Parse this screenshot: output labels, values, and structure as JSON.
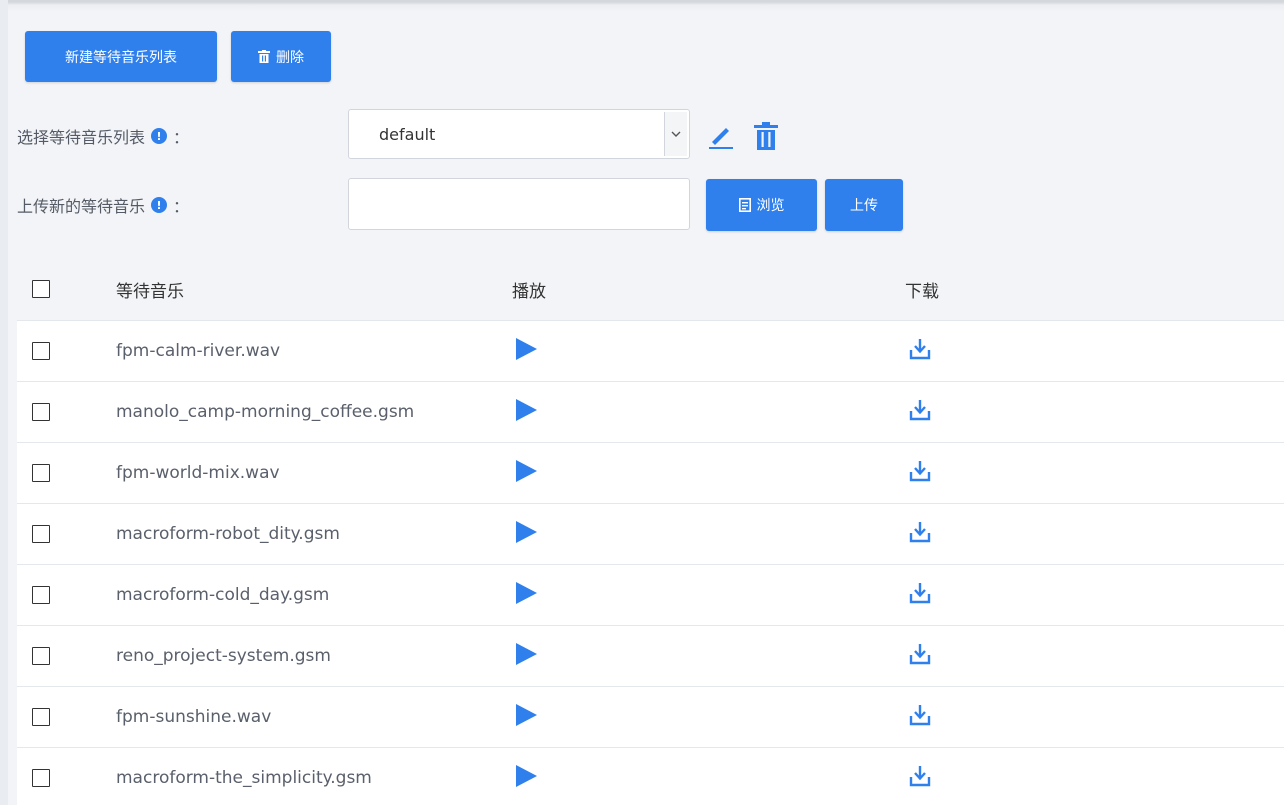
{
  "toolbar": {
    "new_list_label": "新建等待音乐列表",
    "delete_label": "删除"
  },
  "form": {
    "select_list_label": "选择等待音乐列表",
    "select_value": "default",
    "upload_label": "上传新的等待音乐",
    "upload_input_value": "",
    "browse_label": "浏览",
    "upload_button_label": "上传",
    "colon": "："
  },
  "table": {
    "headers": {
      "name": "等待音乐",
      "play": "播放",
      "download": "下载"
    },
    "rows": [
      {
        "name": "fpm-calm-river.wav"
      },
      {
        "name": "manolo_camp-morning_coffee.gsm"
      },
      {
        "name": "fpm-world-mix.wav"
      },
      {
        "name": "macroform-robot_dity.gsm"
      },
      {
        "name": "macroform-cold_day.gsm"
      },
      {
        "name": "reno_project-system.gsm"
      },
      {
        "name": "fpm-sunshine.wav"
      },
      {
        "name": "macroform-the_simplicity.gsm"
      }
    ]
  },
  "icons": {
    "info": "info-icon",
    "edit": "pencil-icon",
    "delete": "trash-icon",
    "browse": "file-icon",
    "play": "play-icon",
    "download": "download-icon"
  },
  "colors": {
    "accent": "#2f80ed",
    "background": "#f2f4f7"
  }
}
